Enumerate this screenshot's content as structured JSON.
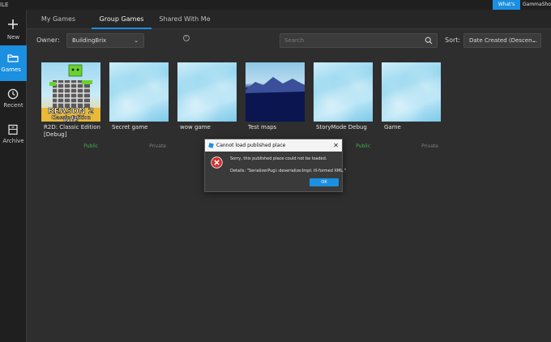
{
  "topbar": {
    "file_label": "ILE",
    "whats_new_label": "What's New",
    "username": "GammaShock"
  },
  "sidebar": {
    "items": [
      {
        "label": "New",
        "icon": "plus-icon"
      },
      {
        "label": "y Games",
        "icon": "folder-icon",
        "active": true
      },
      {
        "label": "Recent",
        "icon": "clock-icon"
      },
      {
        "label": "Archive",
        "icon": "archive-icon"
      }
    ]
  },
  "tabs": [
    {
      "label": "My Games"
    },
    {
      "label": "Group Games",
      "active": true
    },
    {
      "label": "Shared With Me"
    }
  ],
  "filters": {
    "owner_label": "Owner:",
    "owner_value": "BuildingBrix",
    "search_placeholder": "Search",
    "sort_label": "Sort:",
    "sort_value": "Date Created (Descen..."
  },
  "games": [
    {
      "name": "R2D: Classic Edition [Debug]",
      "visibility": "Public",
      "thumb": "art",
      "thumb_text_1": "REASON 2 DIE",
      "thumb_text_2": "Classic Edition"
    },
    {
      "name": "Secret game",
      "visibility": "Private",
      "thumb": "sky"
    },
    {
      "name": "wow game",
      "visibility": "",
      "thumb": "sky"
    },
    {
      "name": "Test maps",
      "visibility": "",
      "thumb": "mountain"
    },
    {
      "name": "StoryMode Debug",
      "visibility": "Public",
      "thumb": "sky"
    },
    {
      "name": "Game",
      "visibility": "Private",
      "thumb": "sky"
    }
  ],
  "dialog": {
    "title": "Cannot load published place",
    "close_label": "✕",
    "message": "Sorry, this published place could not be loaded.",
    "details": "Details: \"SerializerPugi::deserialize:Impl: ill-formed XML.\"",
    "ok_label": "OK"
  },
  "colors": {
    "accent": "#1b8fe0",
    "public": "#3cb44b",
    "private": "#7f7f7f",
    "error": "#d32f2f"
  }
}
